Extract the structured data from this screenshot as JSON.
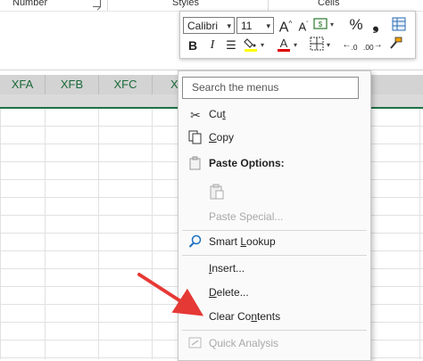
{
  "ribbon": {
    "groups": [
      "Number",
      "Styles",
      "Cells"
    ]
  },
  "sheet": {
    "columns": [
      "XFA",
      "XFB",
      "XFC",
      "X"
    ]
  },
  "mini_toolbar": {
    "font_name": "Calibri",
    "font_size": "11",
    "bold": "B",
    "italic": "I",
    "fill_color": "#FFFF00",
    "font_color": "#E00000"
  },
  "context_menu": {
    "search_placeholder": "Search the menus",
    "cut": {
      "pre": "Cu",
      "key": "t",
      "post": ""
    },
    "copy": {
      "pre": "",
      "key": "C",
      "post": "opy"
    },
    "paste_options": "Paste Options:",
    "paste_special": "Paste Special...",
    "smart_lookup": {
      "pre": "Smart ",
      "key": "L",
      "post": "ookup"
    },
    "insert": {
      "pre": "",
      "key": "I",
      "post": "nsert..."
    },
    "delete": {
      "pre": "",
      "key": "D",
      "post": "elete..."
    },
    "clear_contents": {
      "pre": "Clear Co",
      "key": "n",
      "post": "tents"
    },
    "quick_analysis": "Quick Analysis"
  },
  "colors": {
    "header_accent": "#1e7145",
    "arrow": "#e53935"
  }
}
